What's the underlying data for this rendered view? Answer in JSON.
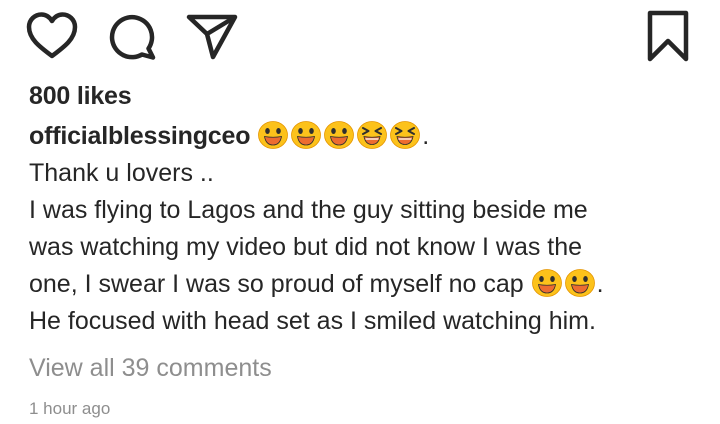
{
  "actions": {
    "like_icon": "heart-outline",
    "comment_icon": "speech-bubble",
    "share_icon": "paper-plane",
    "save_icon": "bookmark-outline"
  },
  "likes": {
    "text": "800 likes"
  },
  "caption": {
    "username": "officialblessingceo",
    "username_suffix": ".",
    "username_emojis": [
      "grinning-face",
      "grinning-face",
      "grinning-face",
      "squinting-face",
      "squinting-face"
    ],
    "line1": "Thank u lovers ..",
    "line2": "I was flying to Lagos and the guy sitting beside me",
    "line3": "was watching my video but did not know I was the",
    "line4_text": "one, I swear I was so proud of myself no cap",
    "line4_emojis": [
      "grinning-face",
      "grinning-face"
    ],
    "line4_suffix": ".",
    "line5": "He focused  with head set as I smiled watching him."
  },
  "comments": {
    "view_all": "View all 39 comments"
  },
  "meta": {
    "timestamp": "1 hour ago"
  },
  "colors": {
    "text": "#262626",
    "secondary_text": "#8e8e8e",
    "emoji_fill": "#fcc21b",
    "emoji_mouth": "#ed6c30",
    "emoji_outline": "#e59600"
  }
}
